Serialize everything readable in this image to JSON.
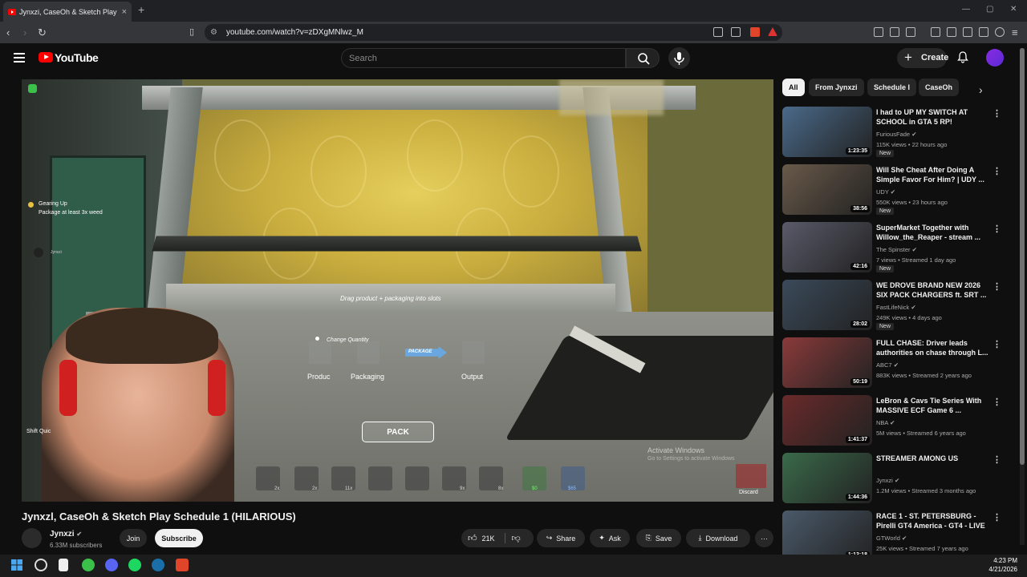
{
  "browser": {
    "tab_title": "Jynxzi, CaseOh & Sketch Play",
    "url": "youtube.com/watch?v=zDXgMNlwz_M"
  },
  "header": {
    "logo_text": "YouTube",
    "search_placeholder": "Search",
    "create_label": "Create"
  },
  "game_hud": {
    "quest_title": "Gearing Up",
    "quest_desc": "Package at least 3x weed",
    "player_name": "Jynxzi",
    "hint": "Drag product + packaging into slots",
    "change_quantity": "Change Quantity",
    "package_label": "PACKAGE",
    "slot_product": "Produc",
    "slot_packaging": "Packaging",
    "slot_output": "Output",
    "pack_button": "PACK",
    "discard": "Discard",
    "cash": "$0",
    "online": "$65",
    "shift_hint": "Shift  Quic",
    "hotbar_counts": [
      "2x",
      "2x",
      "11x",
      "9x",
      "8x"
    ],
    "activate_title": "Activate Windows",
    "activate_sub": "Go to Settings to activate Windows"
  },
  "video": {
    "title": "Jynxzl, CaseOh & Sketch Play Schedule 1 (HILARIOUS)",
    "channel": "Jynxzi",
    "subscribers": "6.33M subscribers",
    "join": "Join",
    "subscribe": "Subscribe",
    "likes": "21K",
    "share": "Share",
    "ask": "Ask",
    "save": "Save",
    "download": "Download"
  },
  "chips": [
    "All",
    "From Jynxzi",
    "Schedule I",
    "CaseOh"
  ],
  "recommendations": [
    {
      "title": "I had to UP MY SWITCH AT SCHOOL in GTA 5 RP!",
      "channel": "FuriousFade",
      "meta": "115K views • 22 hours ago",
      "badge": "New",
      "duration": "1:23:35",
      "color": "#4a6a8a"
    },
    {
      "title": "Will She Cheat After Doing A Simple Favor For Him? | UDY ...",
      "channel": "UDY",
      "meta": "550K views • 23 hours ago",
      "badge": "New",
      "duration": "38:56",
      "color": "#6a5a4a"
    },
    {
      "title": "SuperMarket Together with Willow_the_Reaper - stream ...",
      "channel": "The Spinster",
      "meta": "7 views • Streamed 1 day ago",
      "badge": "New",
      "duration": "42:16",
      "color": "#5a5a6a"
    },
    {
      "title": "WE DROVE BRAND NEW 2026 SIX PACK CHARGERS ft. SRT ...",
      "channel": "FastLifeNick",
      "meta": "249K views • 4 days ago",
      "badge": "New",
      "duration": "28:02",
      "color": "#3a4a5a"
    },
    {
      "title": "FULL CHASE: Driver leads authorities on chase through L...",
      "channel": "ABC7",
      "meta": "883K views • Streamed 2 years ago",
      "badge": "",
      "duration": "50:19",
      "color": "#8a3a3a"
    },
    {
      "title": "LeBron & Cavs Tie Series With MASSIVE ECF Game 6 ...",
      "channel": "NBA",
      "meta": "5M views • Streamed 6 years ago",
      "badge": "",
      "duration": "1:41:37",
      "color": "#6a2a2a"
    },
    {
      "title": "STREAMER AMONG US",
      "channel": "Jynxzi",
      "meta": "1.2M views • Streamed 3 months ago",
      "badge": "",
      "duration": "1:44:36",
      "color": "#3a6a4a"
    },
    {
      "title": "RACE 1 - ST. PETERSBURG - Pirelli GT4 America - GT4 - LIVE",
      "channel": "GTWorld",
      "meta": "25K views • Streamed 7 years ago",
      "badge": "",
      "duration": "1:13:18",
      "color": "#4a5a6a"
    }
  ],
  "taskbar": {
    "time": "4:23 PM",
    "date": "4/21/2026"
  }
}
